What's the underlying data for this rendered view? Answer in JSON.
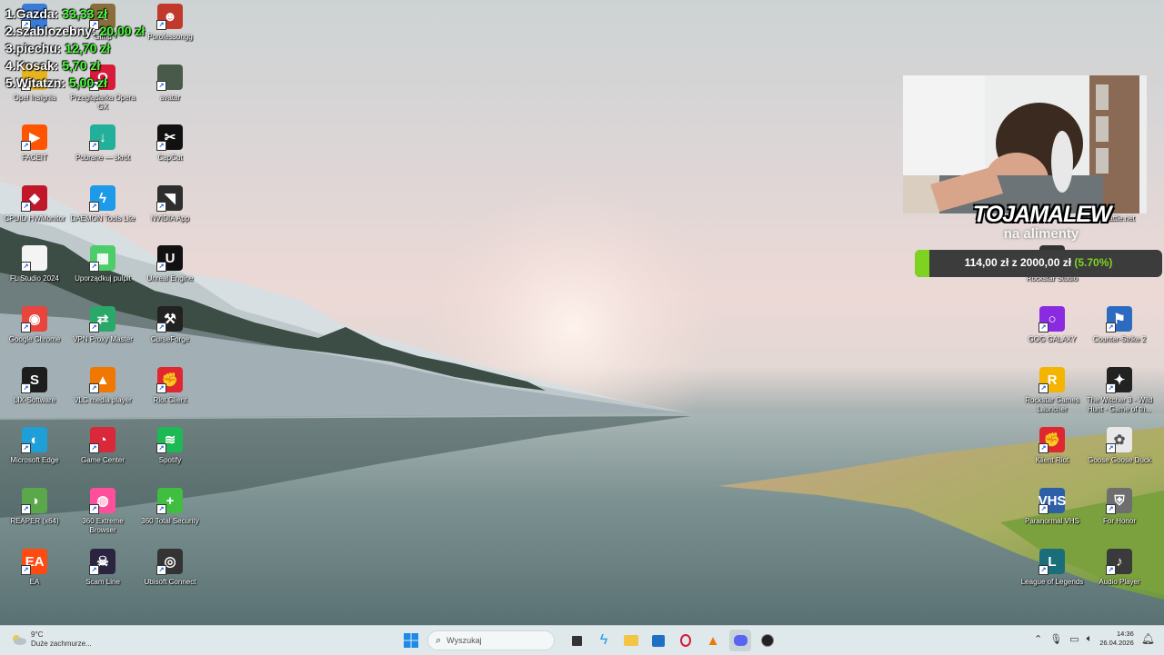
{
  "overlay": {
    "leaderboard": [
      {
        "name": "1.Gazda:",
        "amount": "33,33 zł"
      },
      {
        "name": "2.szablozebny:",
        "amount": "20,00 zł"
      },
      {
        "name": "3.piechu:",
        "amount": "12,70 zł"
      },
      {
        "name": "4.Kosak:",
        "amount": "5,70 zł"
      },
      {
        "name": "5.Witatzn:",
        "amount": "5,00 zł"
      }
    ],
    "streamer_name": "TOJAMALEW",
    "streamer_subtitle": "na alimenty",
    "goal": {
      "current": "114,00 zł",
      "separator": "z",
      "target": "2000,00 zł",
      "percent": "(5.70%)",
      "fraction": 0.057,
      "fill_color": "#7ed321"
    }
  },
  "desktop_icons": [
    {
      "label": "",
      "icon": "windows-file-icon",
      "color": "#3a7bd5"
    },
    {
      "label": "Gimp",
      "icon": "gimp-icon",
      "color": "#8a6d3b"
    },
    {
      "label": "Porofessongg",
      "icon": "porofessor-icon",
      "color": "#c0392b"
    },
    {
      "label": "Opel Insignia",
      "icon": "folder-icon",
      "color": "#e6b422"
    },
    {
      "label": "Przeglądarka Opera GX",
      "icon": "opera-gx-icon",
      "color": "#d81b3a"
    },
    {
      "label": "avatar",
      "icon": "avatar-image-icon",
      "color": "#4a5a4a"
    },
    {
      "label": "FACEIT",
      "icon": "faceit-icon",
      "color": "#ff5500"
    },
    {
      "label": "Pobrane — skrót",
      "icon": "downloads-folder-icon",
      "color": "#23b09b"
    },
    {
      "label": "CapCut",
      "icon": "capcut-icon",
      "color": "#111111"
    },
    {
      "label": "CPUID HWMonitor",
      "icon": "hwmonitor-icon",
      "color": "#c0182a"
    },
    {
      "label": "DAEMON Tools Lite",
      "icon": "daemon-tools-icon",
      "color": "#1e9be8"
    },
    {
      "label": "NVIDIA App",
      "icon": "nvidia-icon",
      "color": "#2e2e2e"
    },
    {
      "label": "FL Studio 2024",
      "icon": "document-icon",
      "color": "#f4f4f4"
    },
    {
      "label": "Uporządkuj pulpit",
      "icon": "tidy-desktop-icon",
      "color": "#4ccd6a"
    },
    {
      "label": "Unreal Engine",
      "icon": "unreal-engine-icon",
      "color": "#111111"
    },
    {
      "label": "Google Chrome",
      "icon": "chrome-icon",
      "color": "#e8453c"
    },
    {
      "label": "VPN Proxy Master",
      "icon": "vpn-icon",
      "color": "#2aa868"
    },
    {
      "label": "CurseForge",
      "icon": "curseforge-icon",
      "color": "#222222"
    },
    {
      "label": "LIX-Software",
      "icon": "lix-icon",
      "color": "#1d1d1d"
    },
    {
      "label": "VLC media player",
      "icon": "vlc-icon",
      "color": "#f07800"
    },
    {
      "label": "Riot Client",
      "icon": "riot-client-icon",
      "color": "#e0262f"
    },
    {
      "label": "Microsoft Edge",
      "icon": "edge-icon",
      "color": "#1f9fd8"
    },
    {
      "label": "Game Center",
      "icon": "game-center-icon",
      "color": "#d9283a"
    },
    {
      "label": "Spotify",
      "icon": "spotify-icon",
      "color": "#1db954"
    },
    {
      "label": "REAPER (x64)",
      "icon": "reaper-icon",
      "color": "#5aa84a"
    },
    {
      "label": "360 Extreme Browser",
      "icon": "360-browser-icon",
      "color": "#ff4f9a"
    },
    {
      "label": "360 Total Security",
      "icon": "360-security-icon",
      "color": "#3fbe3f"
    },
    {
      "label": "EA",
      "icon": "ea-icon",
      "color": "#ff4a12"
    },
    {
      "label": "Scam Line",
      "icon": "scam-line-icon",
      "color": "#2a2440"
    },
    {
      "label": "Ubisoft Connect",
      "icon": "ubisoft-icon",
      "color": "#333333"
    },
    {
      "label": "GOG GALAXY",
      "icon": "gog-galaxy-icon",
      "color": "#8a2be2"
    },
    {
      "label": "Counter-Strike 2",
      "icon": "cs2-icon",
      "color": "#2c6bbf"
    },
    {
      "label": "Rockstar Games Launcher",
      "icon": "rockstar-icon",
      "color": "#f4b400"
    },
    {
      "label": "The Witcher 3 - Wild Hunt - Game of th...",
      "icon": "witcher-icon",
      "color": "#222222"
    },
    {
      "label": "Klient Riot",
      "icon": "riot-client-icon",
      "color": "#e0262f"
    },
    {
      "label": "Goose Goose Duck",
      "icon": "goose-duck-icon",
      "color": "#e9e9e9"
    },
    {
      "label": "Paranormal VHS",
      "icon": "paranormal-vhs-icon",
      "color": "#2c5fa8"
    },
    {
      "label": "For Honor",
      "icon": "for-honor-icon",
      "color": "#6e6e6e"
    },
    {
      "label": "League of Legends",
      "icon": "league-icon",
      "color": "#1a6e7a"
    },
    {
      "label": "Audio Player",
      "icon": "audio-player-icon",
      "color": "#3a3a3a"
    },
    {
      "label": "Battle.net",
      "icon": "battlenet-icon",
      "color": "#6b2f1c"
    },
    {
      "label": "Rockstar Studio",
      "icon": "rockstar-studio-icon",
      "color": "#333333"
    }
  ],
  "taskbar": {
    "weather_temp": "9°C",
    "weather_desc": "Duże zachmurze...",
    "search_placeholder": "Wyszukaj",
    "apps": [
      "start-icon",
      "task-view-icon",
      "daemon-tools-icon",
      "file-explorer-icon",
      "microsoft-store-icon",
      "opera-gx-icon",
      "vlc-icon",
      "discord-icon",
      "obs-icon"
    ],
    "clock_time": "14:36",
    "clock_date": "26.04.2026"
  }
}
